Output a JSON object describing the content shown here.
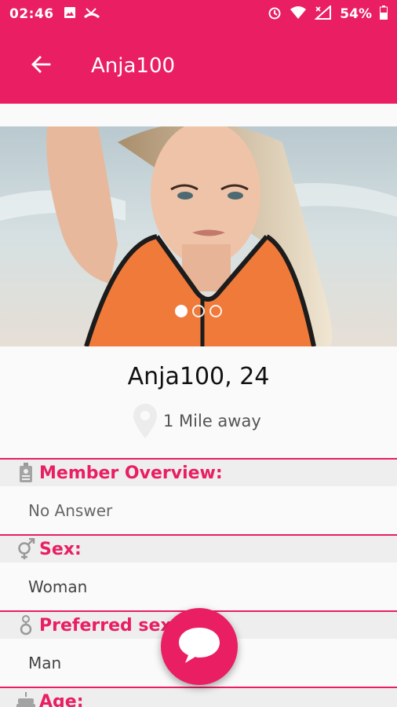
{
  "status_bar": {
    "time": "02:46",
    "battery": "54%",
    "icons": [
      "image-icon",
      "missed-call-icon",
      "alarm-icon",
      "wifi-icon",
      "signal-icon",
      "battery-icon"
    ]
  },
  "app_bar": {
    "title": "Anja100",
    "back_icon": "arrow-left-icon"
  },
  "photo": {
    "page_count": 3,
    "active_index": 0
  },
  "profile": {
    "name_age": "Anja100, 24",
    "distance": "1 Mile away"
  },
  "sections": [
    {
      "icon": "id-badge-icon",
      "label": "Member Overview:",
      "value": "No Answer"
    },
    {
      "icon": "gender-icon",
      "label": "Sex:",
      "value": "Woman"
    },
    {
      "icon": "preferred-sex-icon",
      "label": "Preferred sex:",
      "value": "Man"
    },
    {
      "icon": "cake-icon",
      "label": "Age:",
      "value": ""
    }
  ],
  "fab": {
    "icon": "chat-bubble-icon"
  },
  "colors": {
    "primary": "#e91e63",
    "section_bg": "#eeeeee",
    "background": "#fafafa"
  }
}
